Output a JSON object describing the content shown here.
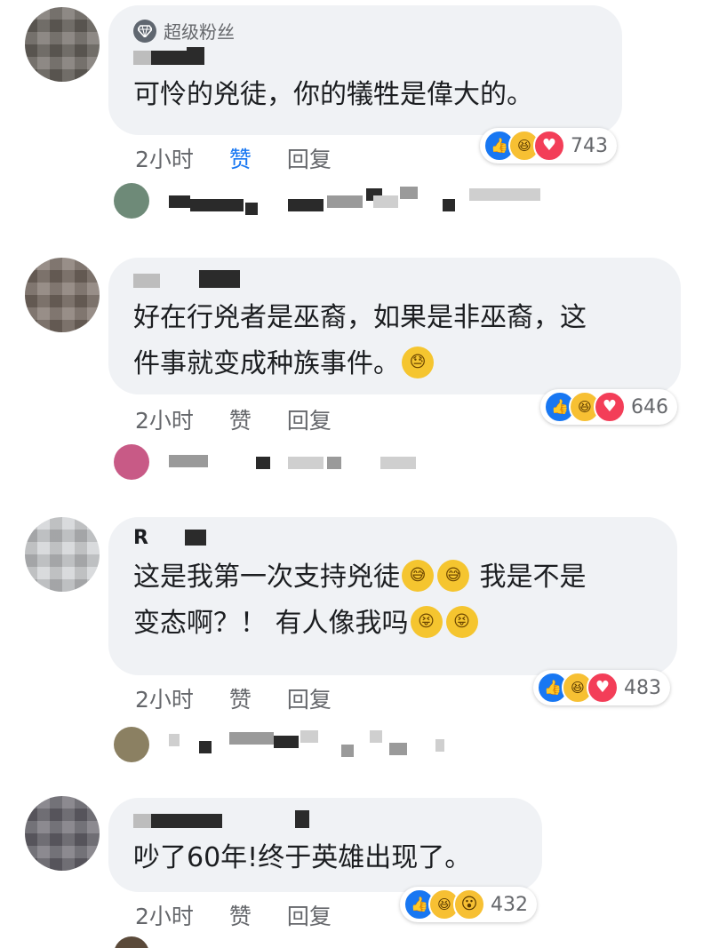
{
  "comments": [
    {
      "badge": "超级粉丝",
      "text": "可怜的兇徒，你的犠牲是偉大的。",
      "time": "2小时",
      "like_label": "赞",
      "reply_label": "回复",
      "reaction_count": "743",
      "reactions": [
        "like-icon",
        "haha-icon",
        "love-icon"
      ]
    },
    {
      "text": "好在行兇者是巫裔，如果是非巫裔，这\n件事就变成种族事件。",
      "emoji": "sweat-face-emoji",
      "time": "2小时",
      "like_label": "赞",
      "reply_label": "回复",
      "reaction_count": "646",
      "reactions": [
        "like-icon",
        "haha-icon",
        "love-icon"
      ]
    },
    {
      "author_initial": "R",
      "text_line1": "这是我第一次支持兇徒",
      "text_line1b": " 我是不是",
      "text_line2": "变态啊？！ 有人像我吗",
      "time": "2小时",
      "like_label": "赞",
      "reply_label": "回复",
      "reaction_count": "483",
      "reactions": [
        "like-icon",
        "haha-icon",
        "love-icon"
      ]
    },
    {
      "text": "吵了60年!终于英雄出现了。",
      "time": "2小时",
      "like_label": "赞",
      "reply_label": "回复",
      "reaction_count": "432",
      "reactions": [
        "like-icon",
        "haha-icon",
        "wow-icon"
      ]
    }
  ],
  "colors": {
    "accent": "#1877f2",
    "bubble": "#f0f2f5",
    "meta": "#65676b"
  }
}
